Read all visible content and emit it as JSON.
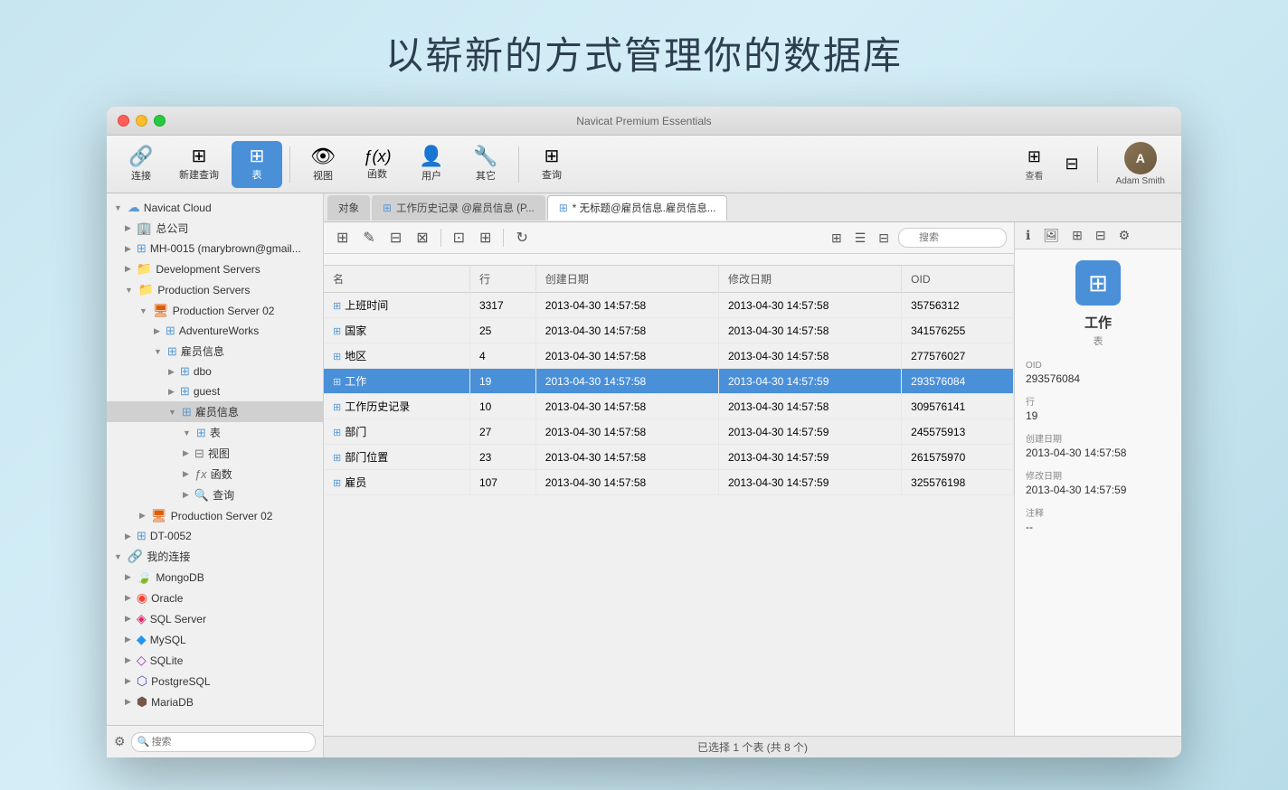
{
  "page": {
    "title": "以崭新的方式管理你的数据库",
    "app_title": "Navicat Premium Essentials"
  },
  "toolbar": {
    "buttons": [
      {
        "id": "connect",
        "label": "连接",
        "icon": "🔗"
      },
      {
        "id": "new-query",
        "label": "新建查询",
        "icon": "⊞"
      },
      {
        "id": "table",
        "label": "表",
        "icon": "⊞",
        "active": true
      },
      {
        "id": "view",
        "label": "视图",
        "icon": "👁"
      },
      {
        "id": "function",
        "label": "函数",
        "icon": "ƒ(x)"
      },
      {
        "id": "user",
        "label": "用户",
        "icon": "👤"
      },
      {
        "id": "other",
        "label": "其它",
        "icon": "🔧"
      },
      {
        "id": "query",
        "label": "查询",
        "icon": "⊞"
      }
    ],
    "view_buttons": [
      "查看"
    ],
    "user": {
      "name": "Adam Smith"
    }
  },
  "sidebar": {
    "search_placeholder": "搜索",
    "items": [
      {
        "id": "navicat-cloud",
        "label": "Navicat Cloud",
        "indent": 0,
        "expanded": true,
        "icon": "cloud"
      },
      {
        "id": "general-company",
        "label": "总公司",
        "indent": 1,
        "expanded": false,
        "icon": "folder"
      },
      {
        "id": "mh-0015",
        "label": "MH-0015 (marybrown@gmail...",
        "indent": 1,
        "expanded": false,
        "icon": "db"
      },
      {
        "id": "development-servers",
        "label": "Development Servers",
        "indent": 1,
        "expanded": false,
        "icon": "folder"
      },
      {
        "id": "production-servers",
        "label": "Production Servers",
        "indent": 1,
        "expanded": true,
        "icon": "folder"
      },
      {
        "id": "production-server-02",
        "label": "Production Server 02",
        "indent": 2,
        "expanded": true,
        "icon": "prod"
      },
      {
        "id": "adventureworks",
        "label": "AdventureWorks",
        "indent": 3,
        "expanded": false,
        "icon": "db"
      },
      {
        "id": "employee-info",
        "label": "雇员信息",
        "indent": 3,
        "expanded": true,
        "icon": "schema"
      },
      {
        "id": "dbo",
        "label": "dbo",
        "indent": 4,
        "expanded": false,
        "icon": "schema"
      },
      {
        "id": "guest",
        "label": "guest",
        "indent": 4,
        "expanded": false,
        "icon": "schema"
      },
      {
        "id": "employee-info-sub",
        "label": "雇员信息",
        "indent": 4,
        "expanded": true,
        "icon": "schema",
        "selected": true
      },
      {
        "id": "tables-folder",
        "label": "表",
        "indent": 5,
        "expanded": true,
        "icon": "table"
      },
      {
        "id": "views-folder",
        "label": "视图",
        "indent": 5,
        "expanded": false,
        "icon": "view"
      },
      {
        "id": "functions-folder",
        "label": "函数",
        "indent": 5,
        "expanded": false,
        "icon": "func"
      },
      {
        "id": "queries-folder",
        "label": "查询",
        "indent": 5,
        "expanded": false,
        "icon": "query"
      },
      {
        "id": "production-server-02b",
        "label": "Production Server 02",
        "indent": 2,
        "expanded": false,
        "icon": "prod2"
      },
      {
        "id": "dt-0052",
        "label": "DT-0052",
        "indent": 1,
        "expanded": false,
        "icon": "db"
      },
      {
        "id": "my-connections",
        "label": "我的连接",
        "indent": 0,
        "expanded": true,
        "icon": "link"
      },
      {
        "id": "mongodb",
        "label": "MongoDB",
        "indent": 1,
        "icon": "mongodb"
      },
      {
        "id": "oracle",
        "label": "Oracle",
        "indent": 1,
        "icon": "oracle"
      },
      {
        "id": "sqlserver",
        "label": "SQL Server",
        "indent": 1,
        "icon": "sqlserver"
      },
      {
        "id": "mysql",
        "label": "MySQL",
        "indent": 1,
        "icon": "mysql"
      },
      {
        "id": "sqlite",
        "label": "SQLite",
        "indent": 1,
        "icon": "sqlite"
      },
      {
        "id": "postgresql",
        "label": "PostgreSQL",
        "indent": 1,
        "icon": "postgresql"
      },
      {
        "id": "mariadb",
        "label": "MariaDB",
        "indent": 1,
        "icon": "mariadb"
      }
    ]
  },
  "tabs": [
    {
      "id": "object",
      "label": "对象",
      "active": false,
      "is_object_tab": true
    },
    {
      "id": "job-history",
      "label": "工作历史记录 @雇员信息 (P...",
      "active": false,
      "icon": "table"
    },
    {
      "id": "untitled",
      "label": "* 无标题@雇员信息.雇员信息...",
      "active": true,
      "icon": "table"
    }
  ],
  "table_data": {
    "columns": [
      "名",
      "行",
      "创建日期",
      "修改日期",
      "OID"
    ],
    "rows": [
      {
        "name": "上班时间",
        "rows": "3317",
        "created": "2013-04-30 14:57:58",
        "modified": "2013-04-30 14:57:58",
        "oid": "35756312",
        "selected": false
      },
      {
        "name": "国家",
        "rows": "25",
        "created": "2013-04-30 14:57:58",
        "modified": "2013-04-30 14:57:58",
        "oid": "341576255",
        "selected": false
      },
      {
        "name": "地区",
        "rows": "4",
        "created": "2013-04-30 14:57:58",
        "modified": "2013-04-30 14:57:58",
        "oid": "277576027",
        "selected": false
      },
      {
        "name": "工作",
        "rows": "19",
        "created": "2013-04-30 14:57:58",
        "modified": "2013-04-30 14:57:59",
        "oid": "293576084",
        "selected": true
      },
      {
        "name": "工作历史记录",
        "rows": "10",
        "created": "2013-04-30 14:57:58",
        "modified": "2013-04-30 14:57:58",
        "oid": "309576141",
        "selected": false
      },
      {
        "name": "部门",
        "rows": "27",
        "created": "2013-04-30 14:57:58",
        "modified": "2013-04-30 14:57:59",
        "oid": "245575913",
        "selected": false
      },
      {
        "name": "部门位置",
        "rows": "23",
        "created": "2013-04-30 14:57:58",
        "modified": "2013-04-30 14:57:59",
        "oid": "261575970",
        "selected": false
      },
      {
        "name": "雇员",
        "rows": "107",
        "created": "2013-04-30 14:57:58",
        "modified": "2013-04-30 14:57:59",
        "oid": "325576198",
        "selected": false
      }
    ]
  },
  "info_panel": {
    "name": "工作",
    "type": "表",
    "fields": [
      {
        "label": "OID",
        "value": "293576084"
      },
      {
        "label": "行",
        "value": "19"
      },
      {
        "label": "创建日期",
        "value": "2013-04-30 14:57:58"
      },
      {
        "label": "修改日期",
        "value": "2013-04-30 14:57:59"
      },
      {
        "label": "注释",
        "value": "--"
      }
    ]
  },
  "status_bar": {
    "text": "已选择 1 个表 (共 8 个)"
  }
}
